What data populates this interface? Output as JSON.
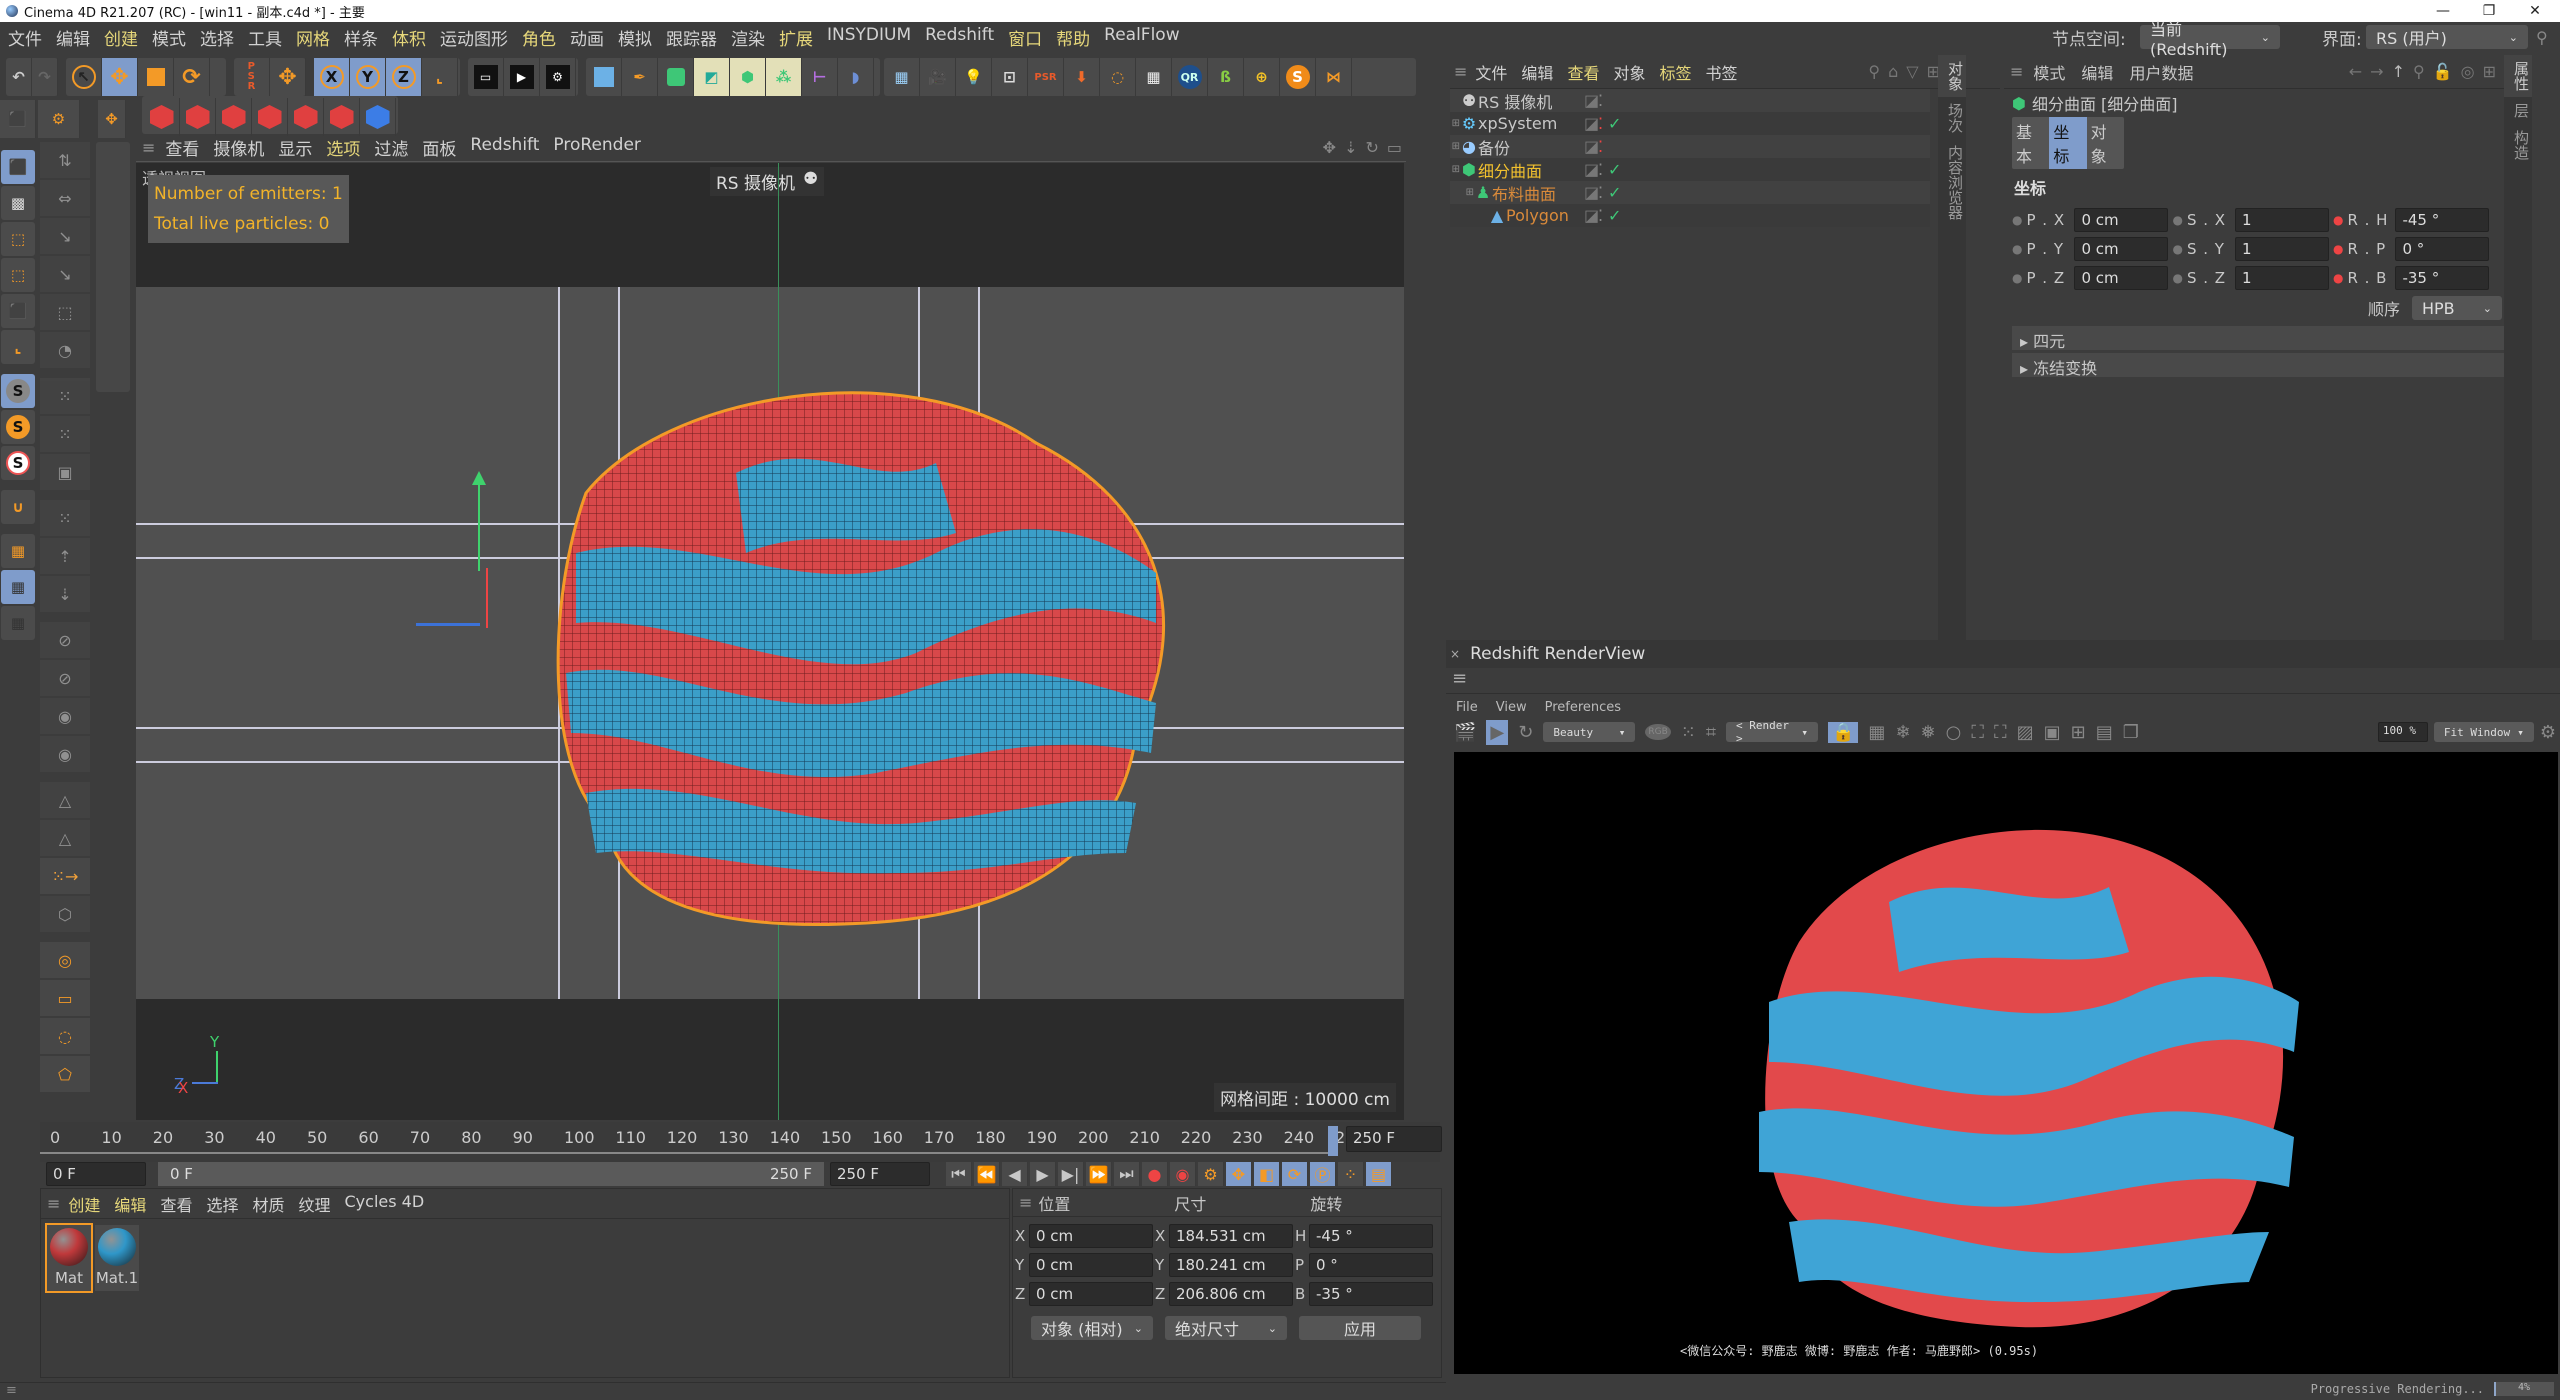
{
  "window": {
    "title": "Cinema 4D R21.207 (RC) - [win11 - 副本.c4d *] - 主要",
    "controls": [
      "minimize",
      "maximize",
      "close"
    ]
  },
  "menubar": {
    "items": [
      {
        "label": "文件",
        "hl": false
      },
      {
        "label": "编辑",
        "hl": false
      },
      {
        "label": "创建",
        "hl": true
      },
      {
        "label": "模式",
        "hl": false
      },
      {
        "label": "选择",
        "hl": false
      },
      {
        "label": "工具",
        "hl": false
      },
      {
        "label": "网格",
        "hl": true
      },
      {
        "label": "样条",
        "hl": false
      },
      {
        "label": "体积",
        "hl": true
      },
      {
        "label": "运动图形",
        "hl": false
      },
      {
        "label": "角色",
        "hl": true
      },
      {
        "label": "动画",
        "hl": false
      },
      {
        "label": "模拟",
        "hl": false
      },
      {
        "label": "跟踪器",
        "hl": false
      },
      {
        "label": "渲染",
        "hl": false
      },
      {
        "label": "扩展",
        "hl": true
      },
      {
        "label": "INSYDIUM",
        "hl": false
      },
      {
        "label": "Redshift",
        "hl": false
      },
      {
        "label": "窗口",
        "hl": true
      },
      {
        "label": "帮助",
        "hl": true
      },
      {
        "label": "RealFlow",
        "hl": false
      }
    ],
    "node_space_label": "节点空间:",
    "node_space_value": "当前 (Redshift)",
    "layout_label": "界面:",
    "layout_value": "RS (用户)"
  },
  "viewport": {
    "menu": [
      {
        "label": "查看",
        "hl": false
      },
      {
        "label": "摄像机",
        "hl": false
      },
      {
        "label": "显示",
        "hl": false
      },
      {
        "label": "选项",
        "hl": true
      },
      {
        "label": "过滤",
        "hl": false
      },
      {
        "label": "面板",
        "hl": false
      },
      {
        "label": "Redshift",
        "hl": false
      },
      {
        "label": "ProRender",
        "hl": false
      }
    ],
    "view_name": "透视视图",
    "camera_label": "RS 摄像机",
    "hud": {
      "emitters": "Number of emitters: 1",
      "particles": "Total live particles: 0"
    },
    "grid_spacing": "网格间距 : 10000 cm",
    "axis_labels": {
      "x": "X",
      "y": "Y",
      "z": "Z"
    },
    "colors": {
      "red": "#d9484a",
      "blue": "#3b9fc8"
    }
  },
  "timeline": {
    "ticks": [
      "0",
      "10",
      "20",
      "30",
      "40",
      "50",
      "60",
      "70",
      "80",
      "90",
      "100",
      "110",
      "120",
      "130",
      "140",
      "150",
      "160",
      "170",
      "180",
      "190",
      "200",
      "210",
      "220",
      "230",
      "240",
      "2"
    ],
    "end_frame": "250 F",
    "current_frame": "0 F",
    "range_start": "0 F",
    "range_end": "250 F",
    "max_frame": "250 F"
  },
  "material_manager": {
    "menu": [
      {
        "label": "创建",
        "hl": true
      },
      {
        "label": "编辑",
        "hl": true
      },
      {
        "label": "查看",
        "hl": false
      },
      {
        "label": "选择",
        "hl": false
      },
      {
        "label": "材质",
        "hl": false
      },
      {
        "label": "纹理",
        "hl": false
      },
      {
        "label": "Cycles 4D",
        "hl": false
      }
    ],
    "materials": [
      {
        "name": "Mat",
        "color": "#c0393b",
        "selected": true
      },
      {
        "name": "Mat.1",
        "color": "#2f97c9",
        "selected": false
      }
    ]
  },
  "coordinates": {
    "headers": [
      "位置",
      "尺寸",
      "旋转"
    ],
    "rows": [
      {
        "pos_label": "X",
        "pos": "0 cm",
        "size_label": "X",
        "size": "184.531 cm",
        "rot_label": "H",
        "rot": "-45 °"
      },
      {
        "pos_label": "Y",
        "pos": "0 cm",
        "size_label": "Y",
        "size": "180.241 cm",
        "rot_label": "P",
        "rot": "0 °"
      },
      {
        "pos_label": "Z",
        "pos": "0 cm",
        "size_label": "Z",
        "size": "206.806 cm",
        "rot_label": "B",
        "rot": "-35 °"
      }
    ],
    "mode": "对象 (相对)",
    "size_mode": "绝对尺寸",
    "apply": "应用"
  },
  "object_manager": {
    "menu": [
      {
        "label": "文件",
        "hl": false
      },
      {
        "label": "编辑",
        "hl": false
      },
      {
        "label": "查看",
        "hl": true
      },
      {
        "label": "对象",
        "hl": false
      },
      {
        "label": "标签",
        "hl": true
      },
      {
        "label": "书签",
        "hl": false
      }
    ],
    "objects": [
      {
        "name": "RS 摄像机",
        "depth": 0,
        "color": "#c8c8c8",
        "expander": "",
        "icon": "camera-icon"
      },
      {
        "name": "xpSystem",
        "depth": 0,
        "color": "#c8c8c8",
        "expander": "+",
        "icon": "xp-system-icon"
      },
      {
        "name": "备份",
        "depth": 0,
        "color": "#c8c8c8",
        "expander": "+",
        "icon": "null-icon"
      },
      {
        "name": "细分曲面",
        "depth": 0,
        "color": "#f2c12e",
        "expander": "-",
        "icon": "subdivision-surface-icon"
      },
      {
        "name": "布料曲面",
        "depth": 1,
        "color": "#d98a3a",
        "expander": "-",
        "icon": "cloth-surface-icon"
      },
      {
        "name": "Polygon",
        "depth": 2,
        "color": "#d98a3a",
        "expander": "",
        "icon": "polygon-icon"
      }
    ],
    "side_tabs": [
      "对象",
      "场次",
      "内容浏览器"
    ]
  },
  "attribute_manager": {
    "menu": [
      "模式",
      "编辑",
      "用户数据"
    ],
    "object_title": "细分曲面 [细分曲面]",
    "tabs": [
      {
        "label": "基本",
        "active": false
      },
      {
        "label": "坐标",
        "active": true
      },
      {
        "label": "对象",
        "active": false
      }
    ],
    "section": "坐标",
    "fields": [
      [
        {
          "label": "P . X",
          "value": "0 cm"
        },
        {
          "label": "S . X",
          "value": "1"
        },
        {
          "label": "R . H",
          "value": "-45 °"
        }
      ],
      [
        {
          "label": "P . Y",
          "value": "0 cm"
        },
        {
          "label": "S . Y",
          "value": "1"
        },
        {
          "label": "R . P",
          "value": "0 °"
        }
      ],
      [
        {
          "label": "P . Z",
          "value": "0 cm"
        },
        {
          "label": "S . Z",
          "value": "1"
        },
        {
          "label": "R . B",
          "value": "-35 °"
        }
      ]
    ],
    "order_label": "顺序",
    "order_value": "HPB",
    "groups": [
      "四元",
      "冻结变换"
    ],
    "side_tabs": [
      "属性",
      "层",
      "构造"
    ]
  },
  "renderview": {
    "title": "Redshift RenderView",
    "menu": [
      "File",
      "View",
      "Preferences"
    ],
    "aov": "Beauty",
    "render_mode": "< Render >",
    "zoom": "100 %",
    "fit": "Fit Window",
    "caption": "<微信公众号: 野鹿志   微博: 野鹿志   作者: 马鹿野郎>  (0.95s)",
    "status": "Progressive Rendering...",
    "progress_percent": 4
  }
}
